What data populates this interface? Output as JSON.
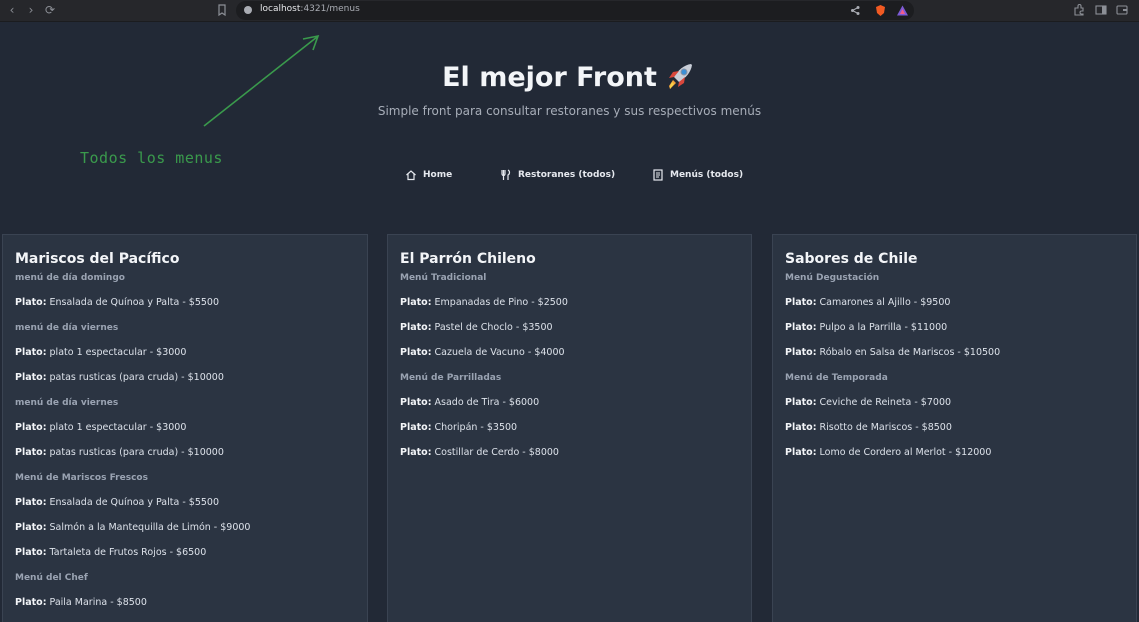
{
  "browser": {
    "url_host": "localhost",
    "url_path": ":4321/menus"
  },
  "header": {
    "title": "El mejor Front",
    "subtitle": "Simple front para consultar restoranes y sus respectivos menús",
    "annotation": "Todos los menus",
    "nav": [
      {
        "label": "Home",
        "icon": "home-icon"
      },
      {
        "label": "Restoranes (todos)",
        "icon": "fork-knife-icon"
      },
      {
        "label": "Menús (todos)",
        "icon": "document-icon"
      }
    ]
  },
  "colors": {
    "background": "#222936",
    "card": "#2b3442",
    "annotation": "#3a9a4c"
  },
  "restaurants": [
    {
      "name": "Mariscos del Pacífico",
      "menus": [
        {
          "name": "menú de día domingo",
          "dishes": [
            "Ensalada de Quínoa y Palta - $5500"
          ]
        },
        {
          "name": "menú de día viernes",
          "dishes": [
            "plato 1 espectacular - $3000",
            "patas rusticas (para cruda) - $10000"
          ]
        },
        {
          "name": "menú de día viernes",
          "dishes": [
            "plato 1 espectacular - $3000",
            "patas rusticas (para cruda) - $10000"
          ]
        },
        {
          "name": "Menú de Mariscos Frescos",
          "dishes": [
            "Ensalada de Quínoa y Palta - $5500",
            "Salmón a la Mantequilla de Limón - $9000",
            "Tartaleta de Frutos Rojos - $6500"
          ]
        },
        {
          "name": "Menú del Chef",
          "dishes": [
            "Paila Marina - $8500"
          ]
        }
      ]
    },
    {
      "name": "El Parrón Chileno",
      "menus": [
        {
          "name": "Menú Tradicional",
          "dishes": [
            "Empanadas de Pino - $2500",
            "Pastel de Choclo - $3500",
            "Cazuela de Vacuno - $4000"
          ]
        },
        {
          "name": "Menú de Parrilladas",
          "dishes": [
            "Asado de Tira - $6000",
            "Choripán - $3500",
            "Costillar de Cerdo - $8000"
          ]
        }
      ]
    },
    {
      "name": "Sabores de Chile",
      "menus": [
        {
          "name": "Menú Degustación",
          "dishes": [
            "Camarones al Ajillo - $9500",
            "Pulpo a la Parrilla - $11000",
            "Róbalo en Salsa de Mariscos - $10500"
          ]
        },
        {
          "name": "Menú de Temporada",
          "dishes": [
            "Ceviche de Reineta - $7000",
            "Risotto de Mariscos - $8500",
            "Lomo de Cordero al Merlot - $12000"
          ]
        }
      ]
    }
  ],
  "dish_prefix": "Plato:"
}
